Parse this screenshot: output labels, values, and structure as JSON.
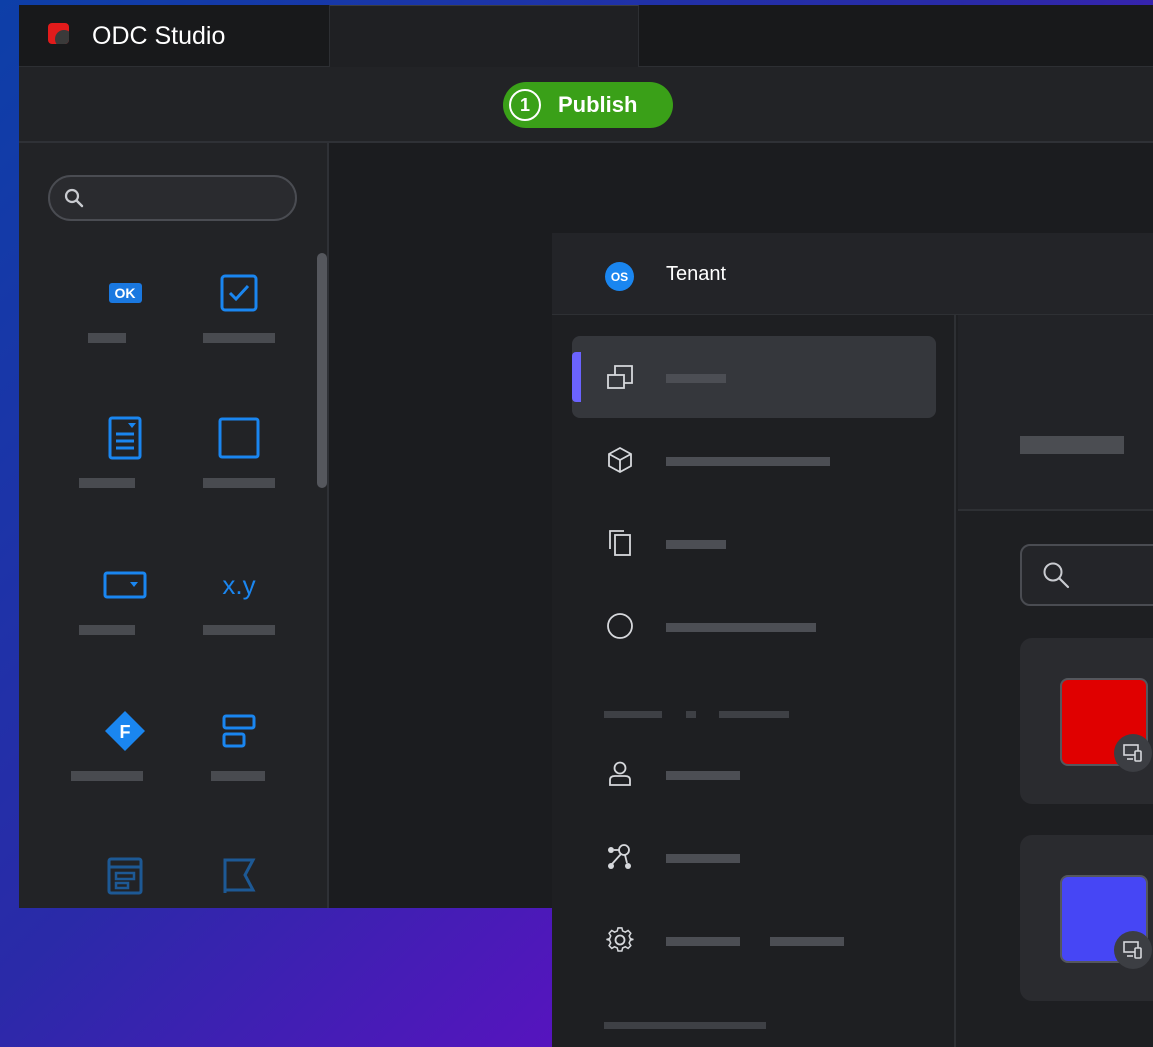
{
  "studio": {
    "app_title": "ODC Studio",
    "publish": {
      "count": "1",
      "label": "Publish"
    },
    "widget_search": {
      "placeholder": ""
    },
    "widgets": [
      {
        "name": "button",
        "icon": "ok-badge-icon",
        "badge": "OK"
      },
      {
        "name": "checkbox",
        "icon": "checkbox-icon"
      },
      {
        "name": "form",
        "icon": "form-icon"
      },
      {
        "name": "container",
        "icon": "container-icon"
      },
      {
        "name": "dropdown",
        "icon": "dropdown-icon"
      },
      {
        "name": "expression",
        "icon": "expression-icon",
        "glyph": "x.y"
      },
      {
        "name": "flow",
        "icon": "flow-icon",
        "glyph": "F"
      },
      {
        "name": "block",
        "icon": "block-icon"
      },
      {
        "name": "list",
        "icon": "list-icon"
      },
      {
        "name": "flag",
        "icon": "flag-icon"
      }
    ]
  },
  "tenant": {
    "badge": "OS",
    "title": "Tenant",
    "nav_icons": [
      "apps-icon",
      "cube-icon",
      "copy-icon",
      "circle-icon",
      "user-icon",
      "graph-icon",
      "gear-icon"
    ],
    "cards": [
      {
        "color": "#e00000"
      },
      {
        "color": "#4646f5"
      }
    ]
  },
  "colors": {
    "accent_blue": "#1a86f0",
    "publish_green": "#3aa018",
    "active_indicator": "#6b63ff"
  }
}
